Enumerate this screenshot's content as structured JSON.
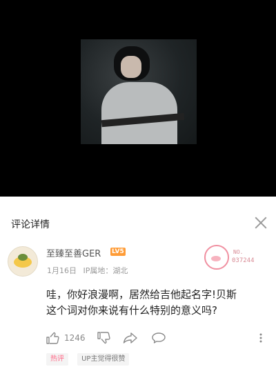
{
  "panel": {
    "title": "评论详情"
  },
  "comment": {
    "username": "至臻至善GER",
    "level_badge": "LV5",
    "date": "1月16日",
    "ip_location": "IP属地：湖北",
    "badge": {
      "no_label": "NO.",
      "number": "037244"
    },
    "text_line1": "哇，你好浪漫啊，居然给吉他起名字!贝斯",
    "text_line2": "这个词对你来说有什么特别的意义吗?",
    "like_count": "1246",
    "tags": [
      "热评",
      "UP主觉得很赞"
    ]
  },
  "icons": {
    "close": "close-icon",
    "like": "thumbs-up-icon",
    "dislike": "thumbs-down-icon",
    "share": "share-icon",
    "reply": "comment-bubble-icon",
    "more": "more-vertical-icon"
  },
  "colors": {
    "level_badge": "#ff9c37",
    "hot_tag_text": "#ff6a88",
    "background_video": "#000000"
  }
}
